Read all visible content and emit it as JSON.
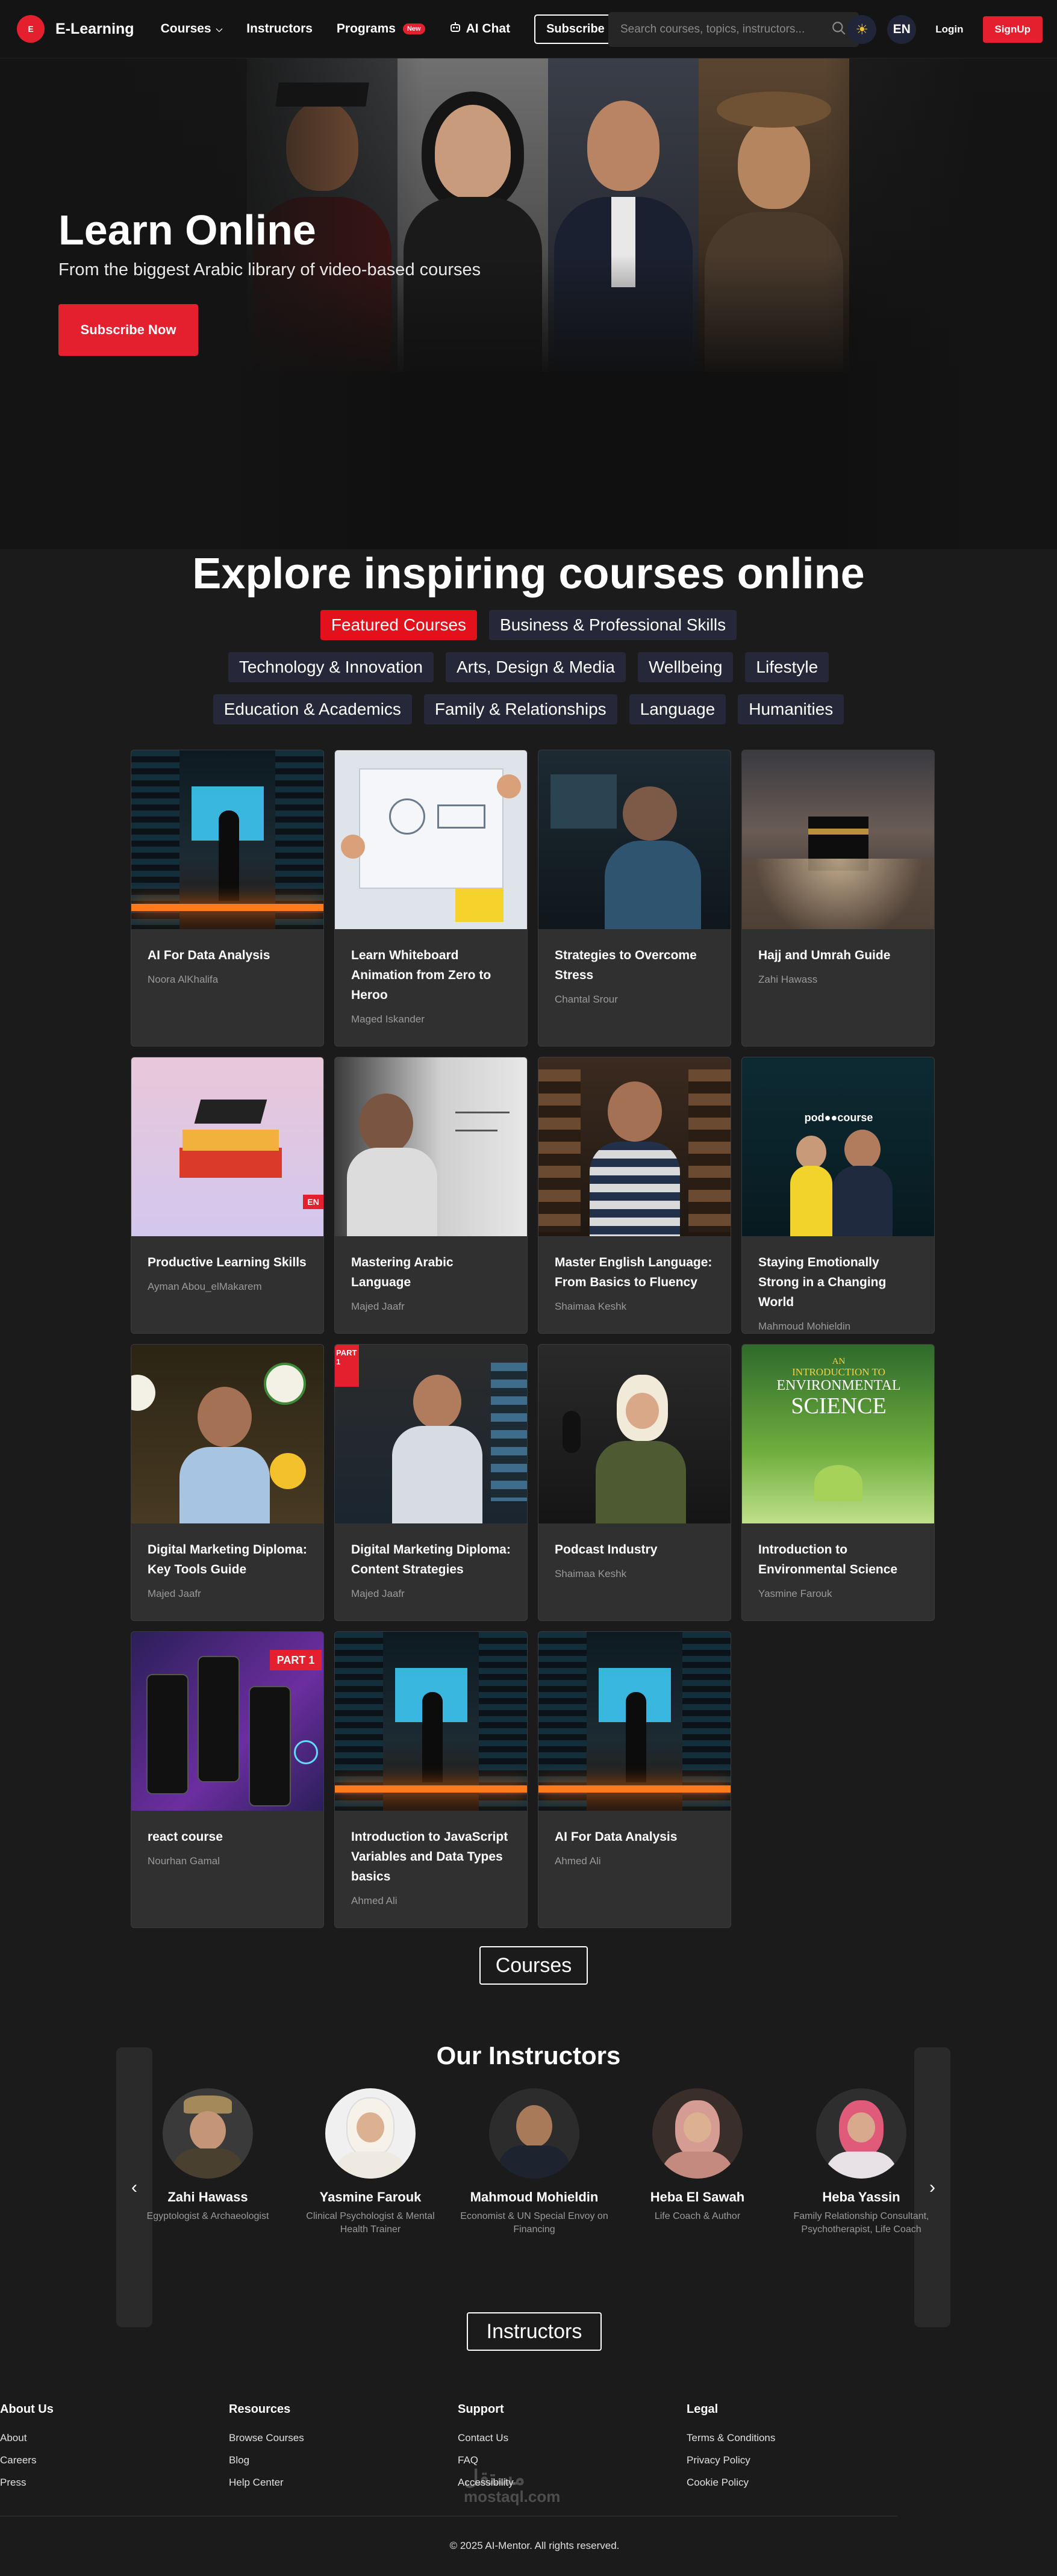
{
  "nav": {
    "brand_name": "E-Learning",
    "logo_text": "E",
    "links": {
      "courses": "Courses",
      "instructors": "Instructors",
      "programs": "Programs",
      "programs_badge": "New",
      "ai_chat": "AI Chat",
      "subscribe": "Subscribe"
    },
    "search_placeholder": "Search courses, topics, instructors...",
    "lang": "EN",
    "login": "Login",
    "signup": "SignUp"
  },
  "hero": {
    "title": "Learn Online",
    "subtitle": "From the biggest Arabic library of video-based courses",
    "cta": "Subscribe Now"
  },
  "explore": {
    "title": "Explore inspiring courses online",
    "chips": [
      [
        "Featured Courses",
        "Business & Professional Skills"
      ],
      [
        "Technology & Innovation",
        "Arts, Design & Media",
        "Wellbeing",
        "Lifestyle"
      ],
      [
        "Education & Academics",
        "Family & Relationships",
        "Language",
        "Humanities"
      ]
    ],
    "active_chip": "Featured Courses"
  },
  "courses": [
    {
      "title": "AI For Data Analysis",
      "instructor": "Noora AlKhalifa",
      "thumb": "robot-server"
    },
    {
      "title": "Learn Whiteboard Animation from Zero to Heroo",
      "instructor": "Maged Iskander",
      "thumb": "whiteboard-sketch"
    },
    {
      "title": "Strategies to Overcome Stress",
      "instructor": "Chantal Srour",
      "thumb": "stressed-man"
    },
    {
      "title": "Hajj and Umrah Guide",
      "instructor": "Zahi Hawass",
      "thumb": "kaaba"
    },
    {
      "title": "Productive Learning Skills",
      "instructor": "Ayman Abou_elMakarem",
      "thumb": "graduation-books",
      "badge": "EN"
    },
    {
      "title": "Mastering Arabic Language",
      "instructor": "Majed Jaafr",
      "thumb": "teacher-board"
    },
    {
      "title": "Master English Language: From Basics to Fluency",
      "instructor": "Shaimaa Keshk",
      "thumb": "man-bookshelf"
    },
    {
      "title": "Staying Emotionally Strong in a Changing World",
      "instructor": "Mahmoud Mohieldin",
      "thumb": "podcourse",
      "overlay": "pod●●course"
    },
    {
      "title": "Digital Marketing Diploma: Key Tools Guide",
      "instructor": "Majed Jaafr",
      "thumb": "marketing-man"
    },
    {
      "title": "Digital Marketing Diploma: Content Strategies",
      "instructor": "Majed Jaafr",
      "thumb": "marketing-phone",
      "overlay": "PART 1"
    },
    {
      "title": "Podcast Industry",
      "instructor": "Shaimaa Keshk",
      "thumb": "podcast-woman"
    },
    {
      "title": "Introduction to Environmental Science",
      "instructor": "Yasmine Farouk",
      "thumb": "env-science",
      "overlay_lines": [
        "AN",
        "INTRODUCTION TO",
        "ENVIRONMENTAL",
        "SCIENCE"
      ]
    },
    {
      "title": "react course",
      "instructor": "Nourhan Gamal",
      "thumb": "react-phones",
      "overlay": "PART 1"
    },
    {
      "title": "Introduction to JavaScript Variables and Data Types basics",
      "instructor": "Ahmed Ali",
      "thumb": "robot-server"
    },
    {
      "title": "AI For Data Analysis",
      "instructor": "Ahmed Ali",
      "thumb": "robot-server"
    }
  ],
  "courses_button": "Courses",
  "instructors": {
    "title": "Our Instructors",
    "list": [
      {
        "name": "Zahi Hawass",
        "role": "Egyptologist & Archaeologist"
      },
      {
        "name": "Yasmine Farouk",
        "role": "Clinical Psychologist & Mental Health Trainer"
      },
      {
        "name": "Mahmoud Mohieldin",
        "role": "Economist & UN Special Envoy on Financing"
      },
      {
        "name": "Heba El Sawah",
        "role": "Life Coach & Author"
      },
      {
        "name": "Heba Yassin",
        "role": "Family Relationship Consultant, Psychotherapist, Life Coach"
      }
    ],
    "button": "Instructors"
  },
  "footer": {
    "columns": [
      {
        "heading": "About Us",
        "links": [
          "About",
          "Careers",
          "Press"
        ]
      },
      {
        "heading": "Resources",
        "links": [
          "Browse Courses",
          "Blog",
          "Help Center"
        ]
      },
      {
        "heading": "Support",
        "links": [
          "Contact Us",
          "FAQ",
          "Accessibility"
        ]
      },
      {
        "heading": "Legal",
        "links": [
          "Terms & Conditions",
          "Privacy Policy",
          "Cookie Policy"
        ]
      }
    ],
    "copyright": "© 2025 AI-Mentor. All rights reserved.",
    "watermark_ar": "مستقل",
    "watermark_en": "mostaql.com"
  },
  "colors": {
    "accent": "#e4202e",
    "chip_bg": "#26283a",
    "card_bg": "#303030",
    "page_bg": "#1b1b1b"
  }
}
